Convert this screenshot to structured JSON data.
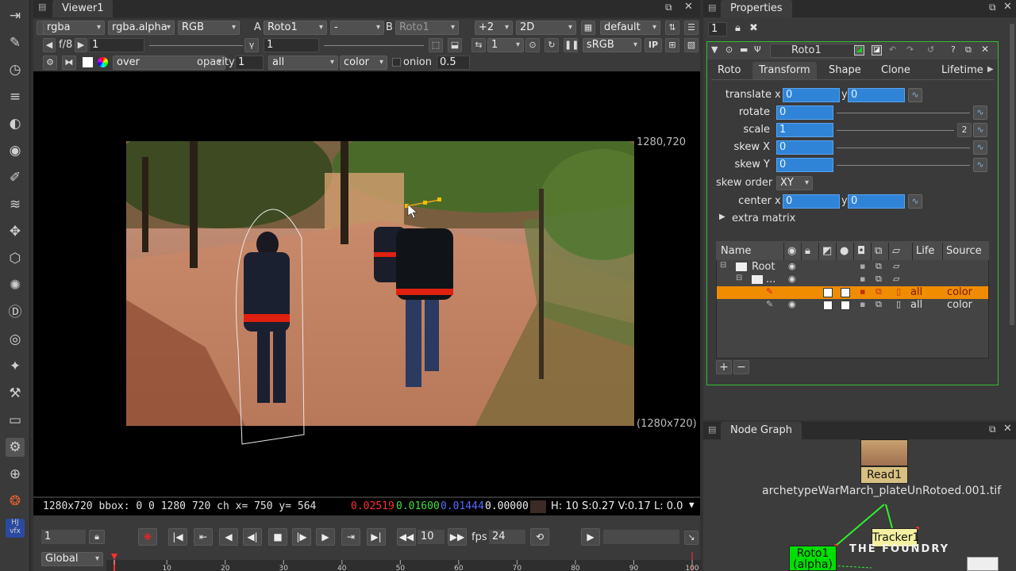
{
  "left_toolbar": {
    "icons": [
      "viewer-icon",
      "paint-icon",
      "time-icon",
      "channel-icon",
      "color-icon",
      "filter-icon",
      "draw-icon",
      "merge-icon",
      "keyer-icon",
      "transform-icon",
      "3d-icon",
      "particles-icon",
      "deep-icon",
      "views-icon",
      "metadata-icon",
      "toolsets-icon",
      "other-icon",
      "ofx-icon",
      "furnace-icon",
      "ocula-icon",
      "hjvfx-icon"
    ],
    "hjvfx_label": "HJ vfx"
  },
  "viewer": {
    "tab_label": "Viewer1",
    "row1": {
      "channels": "rgba",
      "alpha": "rgba.alpha",
      "display": "RGB",
      "a_label": "A",
      "a_input": "Roto1",
      "a_op": "-",
      "b_label": "B",
      "b_input": "Roto1",
      "proxy": "+2",
      "mode": "2D",
      "lut": "default"
    },
    "row2": {
      "fstop": "f/8",
      "gain": "1",
      "gamma_label": "γ",
      "gamma": "1",
      "frame": "1",
      "colorspace": "sRGB",
      "ip": "IP"
    },
    "row3": {
      "composite": "over",
      "opacity_label": "opacity",
      "opacity": "1",
      "all": "all",
      "color": "color",
      "onion_label": "onion",
      "onion": "0.5"
    },
    "format_label_tr": "1280,720",
    "format_label_br": "(1280x720)"
  },
  "status_bar": {
    "info": "1280x720 bbox: 0 0 1280 720 ch  x= 750 y= 564",
    "r": "0.02519",
    "g": "0.01600",
    "b": "0.01444",
    "a": "0.00000",
    "hsv": "H: 10 S:0.27 V:0.17  L: 0.0"
  },
  "timeline": {
    "frame": "1",
    "step": "10",
    "fps_label": "fps",
    "fps": "24",
    "scope": "Global",
    "ticks": [
      "1",
      "10",
      "20",
      "30",
      "40",
      "50",
      "60",
      "70",
      "80",
      "90",
      "100"
    ]
  },
  "properties": {
    "title": "Properties",
    "count": "1",
    "node_name": "Roto1",
    "tabs": [
      "Roto",
      "Transform",
      "Shape",
      "Clone",
      "Lifetime"
    ],
    "active_tab": "Transform",
    "translate": {
      "label": "translate",
      "x_label": "x",
      "x": "0",
      "y_label": "y",
      "y": "0"
    },
    "rotate": {
      "label": "rotate",
      "value": "0"
    },
    "scale": {
      "label": "scale",
      "value": "1",
      "extra": "2"
    },
    "skew_x": {
      "label": "skew X",
      "value": "0"
    },
    "skew_y": {
      "label": "skew Y",
      "value": "0"
    },
    "skew_order": {
      "label": "skew order",
      "value": "XY"
    },
    "center": {
      "label": "center",
      "x_label": "x",
      "x": "0",
      "y_label": "y",
      "y": "0"
    },
    "extra_matrix": "extra matrix",
    "layer_columns": {
      "name": "Name",
      "life": "Life",
      "source": "Source"
    },
    "layers": [
      {
        "name": "Root",
        "life": "",
        "source": ""
      },
      {
        "name": "...",
        "life": "",
        "source": ""
      },
      {
        "name": "",
        "life": "all",
        "source": "color"
      },
      {
        "name": "",
        "life": "all",
        "source": "color"
      }
    ],
    "add_label": "+",
    "remove_label": "−"
  },
  "node_graph": {
    "title": "Node Graph",
    "read_node": "Read1",
    "read_file": "archetypeWarMarch_plateUnRotoed.001.tif",
    "tracker_node": "Tracker1",
    "roto_node": "Roto1",
    "roto_sub": "(alpha)",
    "watermark": "THE FOUNDRY"
  },
  "colors": {
    "accent_blue": "#2f84d8",
    "selected_row": "#f08c00",
    "node_roto": "#00e000",
    "node_tracker": "#f4f0a0",
    "panel_border": "#30c030"
  }
}
